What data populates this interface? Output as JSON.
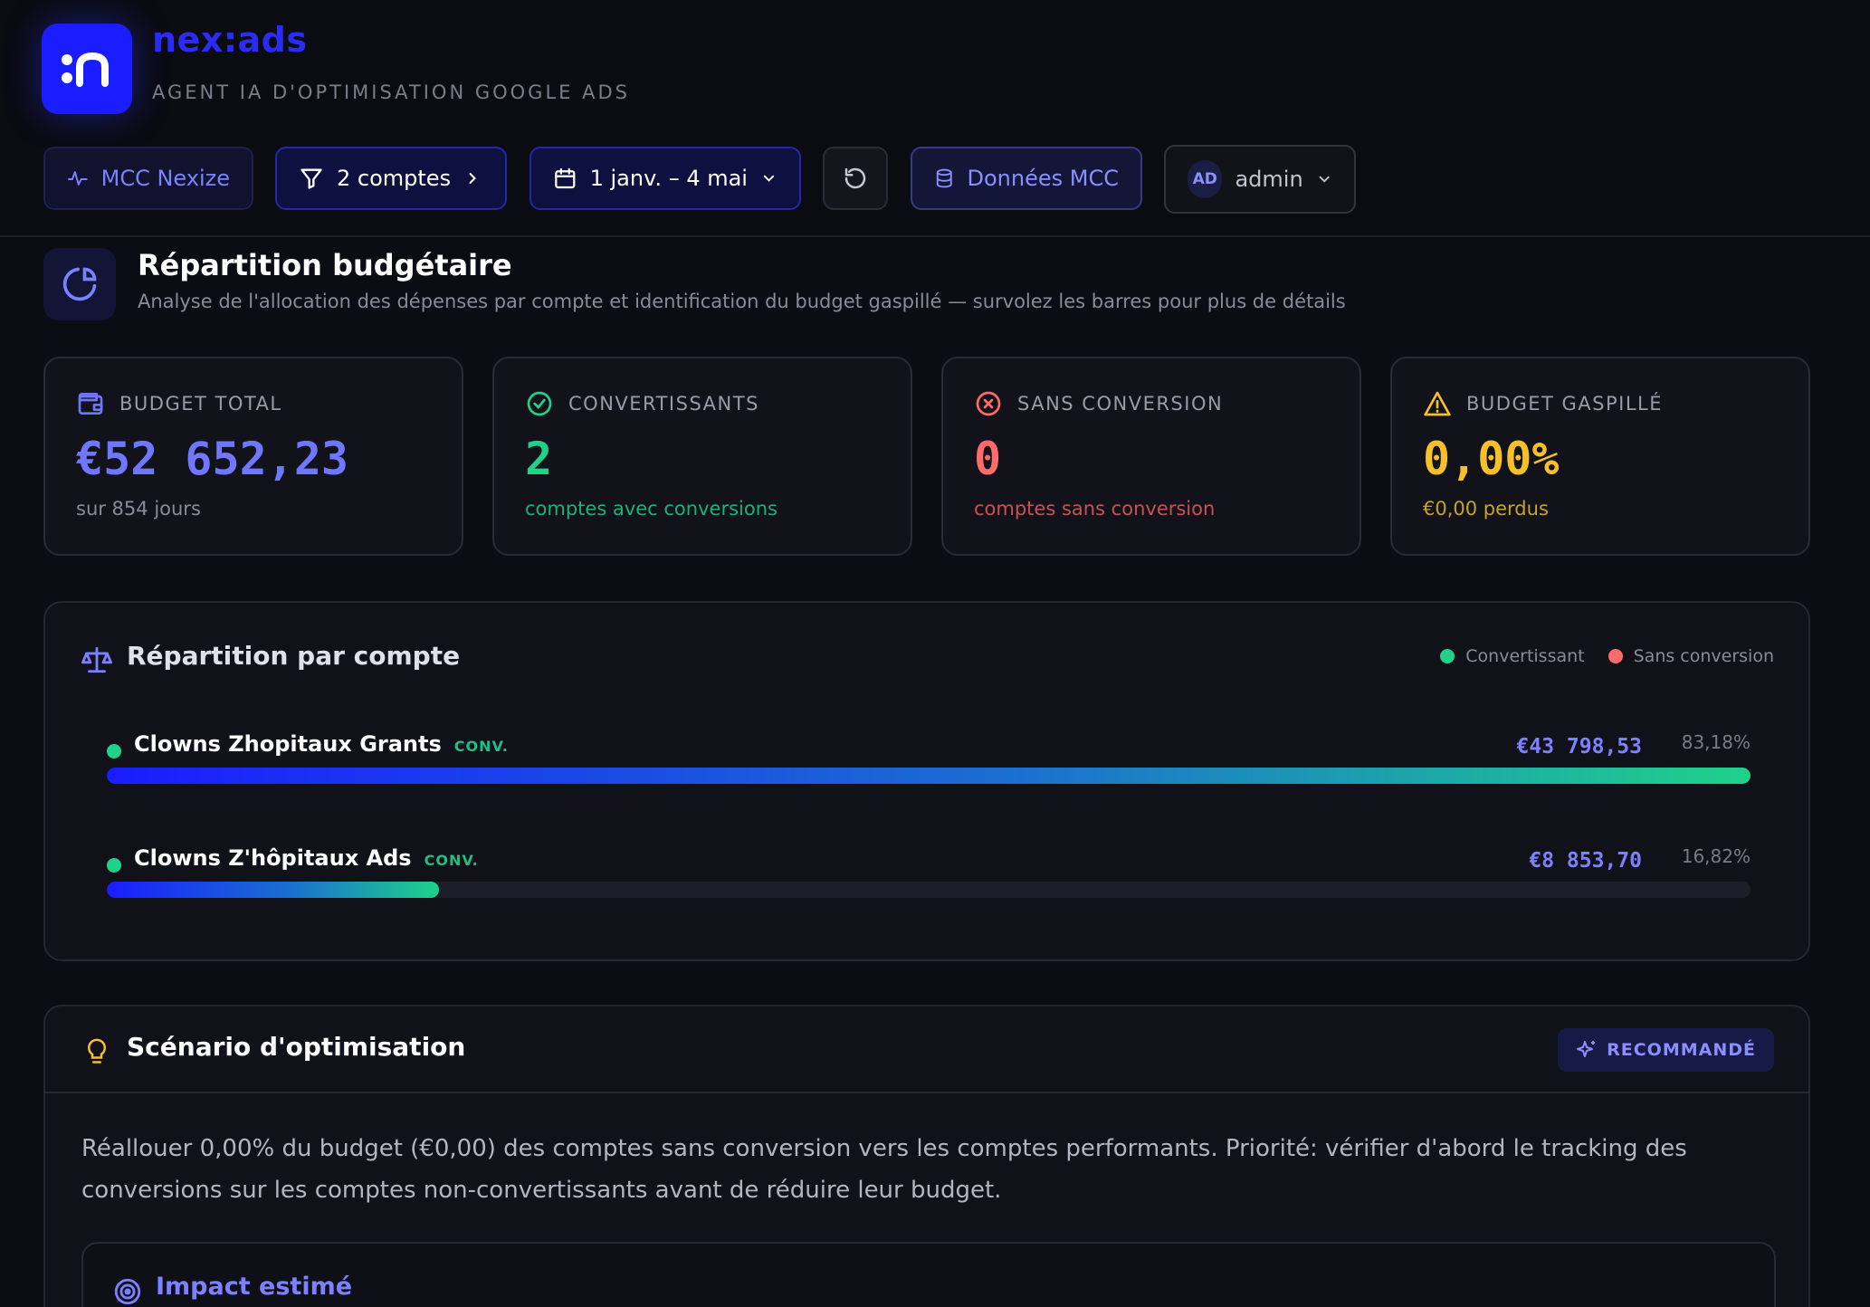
{
  "brand": {
    "name": "nex:ads",
    "subtitle": "AGENT IA D'OPTIMISATION GOOGLE ADS",
    "logo_text": ":n"
  },
  "toolbar": {
    "mcc_label": "MCC Nexize",
    "accounts_label": "2 comptes",
    "date_label": "1 janv. – 4 mai",
    "data_label": "Données MCC",
    "admin_initials": "AD",
    "admin_label": "admin"
  },
  "section": {
    "title": "Répartition budgétaire",
    "description": "Analyse de l'allocation des dépenses par compte et identification du budget gaspillé — survolez les barres pour plus de détails"
  },
  "kpis": [
    {
      "label": "BUDGET TOTAL",
      "value": "€52 652,23",
      "foot": "sur 854 jours",
      "icon": "wallet-icon",
      "color": "#6f76ff",
      "foot_color": "#8a8a9a"
    },
    {
      "label": "CONVERTISSANTS",
      "value": "2",
      "foot": "comptes avec conversions",
      "icon": "check-circle-icon",
      "color": "#1ed28a",
      "foot_color": "#1ab07a"
    },
    {
      "label": "SANS CONVERSION",
      "value": "0",
      "foot": "comptes sans conversion",
      "icon": "x-circle-icon",
      "color": "#ff6b6b",
      "foot_color": "#c85252"
    },
    {
      "label": "BUDGET GASPILLÉ",
      "value": "0,00%",
      "foot": "€0,00 perdus",
      "icon": "warning-icon",
      "color": "#f5c02a",
      "foot_color": "#c9a22c"
    }
  ],
  "distribution": {
    "title": "Répartition par compte",
    "legend": [
      {
        "label": "Convertissant",
        "color": "#1ed28a"
      },
      {
        "label": "Sans conversion",
        "color": "#ff6b6b"
      }
    ],
    "accounts": [
      {
        "name": "Clowns Zhopitaux Grants",
        "tag": "CONV.",
        "amount": "€43 798,53",
        "pct": "83,18%",
        "share": 1.0
      },
      {
        "name": "Clowns Z'hôpitaux Ads",
        "tag": "CONV.",
        "amount": "€8 853,70",
        "pct": "16,82%",
        "share": 0.2022
      }
    ]
  },
  "scenario": {
    "title": "Scénario d'optimisation",
    "badge": "RECOMMANDÉ",
    "text": "Réallouer 0,00% du budget (€0,00) des comptes sans conversion vers les comptes performants. Priorité: vérifier d'abord le tracking des conversions sur les comptes non-convertissants avant de réduire leur budget.",
    "impact_title": "Impact estimé"
  }
}
